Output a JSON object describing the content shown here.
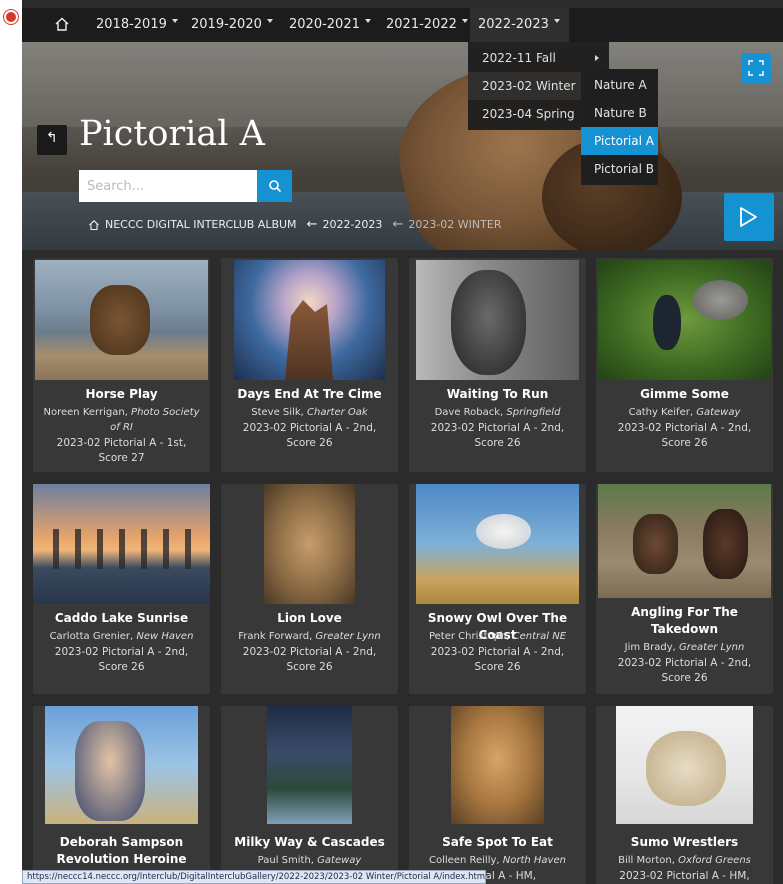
{
  "nav": {
    "items": [
      {
        "label": "2018-2019"
      },
      {
        "label": "2019-2020"
      },
      {
        "label": "2020-2021"
      },
      {
        "label": "2021-2022"
      },
      {
        "label": "2022-2023"
      }
    ]
  },
  "menu": {
    "level1": [
      {
        "label": "2022-11 Fall"
      },
      {
        "label": "2023-02 Winter"
      },
      {
        "label": "2023-04 Spring"
      }
    ],
    "level2": [
      {
        "label": "Nature A"
      },
      {
        "label": "Nature B"
      },
      {
        "label": "Pictorial A"
      },
      {
        "label": "Pictorial B"
      }
    ]
  },
  "page": {
    "title": "Pictorial A",
    "search_placeholder": "Search..."
  },
  "breadcrumb": {
    "home": "NECCC DIGITAL INTERCLUB ALBUM",
    "year": "2022-2023",
    "session": "2023-02 WINTER"
  },
  "cards": [
    {
      "title": "Horse Play",
      "author": "Noreen Kerrigan",
      "club": "Photo Society of RI",
      "award": "2023-02 Pictorial A - 1st, Score 27"
    },
    {
      "title": "Days End At Tre Cime",
      "author": "Steve Silk",
      "club": "Charter Oak",
      "award": "2023-02 Pictorial A - 2nd, Score 26"
    },
    {
      "title": "Waiting To Run",
      "author": "Dave Roback",
      "club": "Springfield",
      "award": "2023-02 Pictorial A - 2nd, Score 26"
    },
    {
      "title": "Gimme Some",
      "author": "Cathy Keifer",
      "club": "Gateway",
      "award": "2023-02 Pictorial A - 2nd, Score 26"
    },
    {
      "title": "Caddo Lake Sunrise",
      "author": "Carlotta Grenier",
      "club": "New Haven",
      "award": "2023-02 Pictorial A - 2nd, Score 26"
    },
    {
      "title": "Lion Love",
      "author": "Frank Forward",
      "club": "Greater Lynn",
      "award": "2023-02 Pictorial A - 2nd, Score 26"
    },
    {
      "title": "Snowy Owl Over The Coast",
      "author": "Peter Christoph",
      "club": "Central NE",
      "award": "2023-02 Pictorial A - 2nd, Score 26"
    },
    {
      "title": "Angling For The Takedown",
      "author": "Jim Brady",
      "club": "Greater Lynn",
      "award": "2023-02 Pictorial A - 2nd, Score 26"
    },
    {
      "title": "Deborah Sampson Revolution Heroine",
      "author": "",
      "club": "",
      "award": ""
    },
    {
      "title": "Milky Way & Cascades",
      "author": "Paul Smith",
      "club": "Gateway",
      "award": ""
    },
    {
      "title": "Safe Spot To Eat",
      "author": "Colleen Reilly",
      "club": "North Haven",
      "award": "ictorial A - HM,"
    },
    {
      "title": "Sumo Wrestlers",
      "author": "Bill Morton",
      "club": "Oxford Greens",
      "award": "2023-02 Pictorial A - HM,"
    }
  ],
  "status_url": "https://neccc14.neccc.org/Interclub/DigitalInterclubGallery/2022-2023/2023-02 Winter/Pictorial A/index.html",
  "colors": {
    "accent": "#1592d2",
    "background": "#2b2b2b",
    "card": "#383838",
    "nav": "#1c1c1c"
  }
}
